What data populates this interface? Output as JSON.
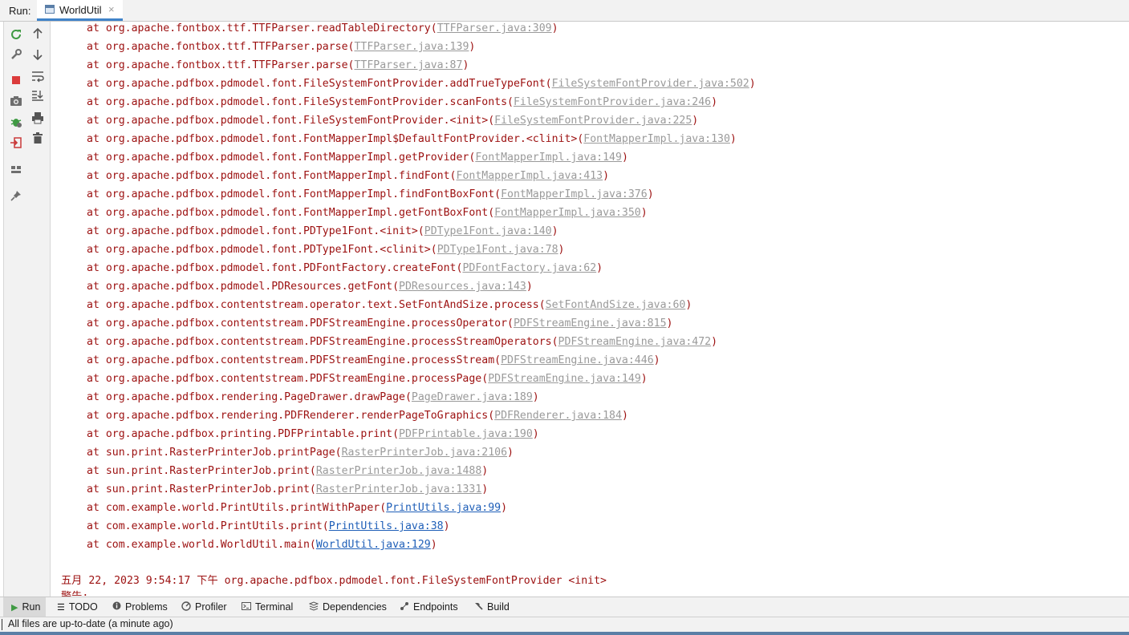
{
  "header": {
    "run_label": "Run:",
    "tab_label": "WorldUtil",
    "tab_close": "×"
  },
  "toolbar": {
    "left_icons": [
      "rerun-icon",
      "wrench-icon",
      "stop-icon",
      "camera-icon",
      "debug-bug-icon",
      "import-arrow-icon",
      "layout-icon",
      "pin-icon"
    ],
    "right_icons": [
      "arrow-up-icon",
      "arrow-down-icon",
      "soft-wrap-icon",
      "scroll-to-end-icon",
      "print-icon",
      "trash-icon"
    ]
  },
  "console": {
    "lines": [
      {
        "prefix": "at org.apache.fontbox.ttf.TTFParser.readTableDirectory(",
        "link": "TTFParser.java:309",
        "suffix": ")",
        "link_color": "gray"
      },
      {
        "prefix": "at org.apache.fontbox.ttf.TTFParser.parse(",
        "link": "TTFParser.java:139",
        "suffix": ")",
        "link_color": "gray"
      },
      {
        "prefix": "at org.apache.fontbox.ttf.TTFParser.parse(",
        "link": "TTFParser.java:87",
        "suffix": ")",
        "link_color": "gray"
      },
      {
        "prefix": "at org.apache.pdfbox.pdmodel.font.FileSystemFontProvider.addTrueTypeFont(",
        "link": "FileSystemFontProvider.java:502",
        "suffix": ")",
        "link_color": "gray"
      },
      {
        "prefix": "at org.apache.pdfbox.pdmodel.font.FileSystemFontProvider.scanFonts(",
        "link": "FileSystemFontProvider.java:246",
        "suffix": ")",
        "link_color": "gray"
      },
      {
        "prefix": "at org.apache.pdfbox.pdmodel.font.FileSystemFontProvider.<init>(",
        "link": "FileSystemFontProvider.java:225",
        "suffix": ")",
        "link_color": "gray"
      },
      {
        "prefix": "at org.apache.pdfbox.pdmodel.font.FontMapperImpl$DefaultFontProvider.<clinit>(",
        "link": "FontMapperImpl.java:130",
        "suffix": ")",
        "link_color": "gray"
      },
      {
        "prefix": "at org.apache.pdfbox.pdmodel.font.FontMapperImpl.getProvider(",
        "link": "FontMapperImpl.java:149",
        "suffix": ")",
        "link_color": "gray"
      },
      {
        "prefix": "at org.apache.pdfbox.pdmodel.font.FontMapperImpl.findFont(",
        "link": "FontMapperImpl.java:413",
        "suffix": ")",
        "link_color": "gray"
      },
      {
        "prefix": "at org.apache.pdfbox.pdmodel.font.FontMapperImpl.findFontBoxFont(",
        "link": "FontMapperImpl.java:376",
        "suffix": ")",
        "link_color": "gray"
      },
      {
        "prefix": "at org.apache.pdfbox.pdmodel.font.FontMapperImpl.getFontBoxFont(",
        "link": "FontMapperImpl.java:350",
        "suffix": ")",
        "link_color": "gray"
      },
      {
        "prefix": "at org.apache.pdfbox.pdmodel.font.PDType1Font.<init>(",
        "link": "PDType1Font.java:140",
        "suffix": ")",
        "link_color": "gray"
      },
      {
        "prefix": "at org.apache.pdfbox.pdmodel.font.PDType1Font.<clinit>(",
        "link": "PDType1Font.java:78",
        "suffix": ")",
        "link_color": "gray"
      },
      {
        "prefix": "at org.apache.pdfbox.pdmodel.font.PDFontFactory.createFont(",
        "link": "PDFontFactory.java:62",
        "suffix": ")",
        "link_color": "gray"
      },
      {
        "prefix": "at org.apache.pdfbox.pdmodel.PDResources.getFont(",
        "link": "PDResources.java:143",
        "suffix": ")",
        "link_color": "gray"
      },
      {
        "prefix": "at org.apache.pdfbox.contentstream.operator.text.SetFontAndSize.process(",
        "link": "SetFontAndSize.java:60",
        "suffix": ")",
        "link_color": "gray"
      },
      {
        "prefix": "at org.apache.pdfbox.contentstream.PDFStreamEngine.processOperator(",
        "link": "PDFStreamEngine.java:815",
        "suffix": ")",
        "link_color": "gray"
      },
      {
        "prefix": "at org.apache.pdfbox.contentstream.PDFStreamEngine.processStreamOperators(",
        "link": "PDFStreamEngine.java:472",
        "suffix": ")",
        "link_color": "gray"
      },
      {
        "prefix": "at org.apache.pdfbox.contentstream.PDFStreamEngine.processStream(",
        "link": "PDFStreamEngine.java:446",
        "suffix": ")",
        "link_color": "gray"
      },
      {
        "prefix": "at org.apache.pdfbox.contentstream.PDFStreamEngine.processPage(",
        "link": "PDFStreamEngine.java:149",
        "suffix": ")",
        "link_color": "gray"
      },
      {
        "prefix": "at org.apache.pdfbox.rendering.PageDrawer.drawPage(",
        "link": "PageDrawer.java:189",
        "suffix": ")",
        "link_color": "gray"
      },
      {
        "prefix": "at org.apache.pdfbox.rendering.PDFRenderer.renderPageToGraphics(",
        "link": "PDFRenderer.java:184",
        "suffix": ")",
        "link_color": "gray"
      },
      {
        "prefix": "at org.apache.pdfbox.printing.PDFPrintable.print(",
        "link": "PDFPrintable.java:190",
        "suffix": ")",
        "link_color": "gray"
      },
      {
        "prefix": "at sun.print.RasterPrinterJob.printPage(",
        "link": "RasterPrinterJob.java:2106",
        "suffix": ")",
        "link_color": "gray"
      },
      {
        "prefix": "at sun.print.RasterPrinterJob.print(",
        "link": "RasterPrinterJob.java:1488",
        "suffix": ")",
        "link_color": "gray"
      },
      {
        "prefix": "at sun.print.RasterPrinterJob.print(",
        "link": "RasterPrinterJob.java:1331",
        "suffix": ")",
        "link_color": "gray"
      },
      {
        "prefix": "at com.example.world.PrintUtils.printWithPaper(",
        "link": "PrintUtils.java:99",
        "suffix": ")",
        "link_color": "blue"
      },
      {
        "prefix": "at com.example.world.PrintUtils.print(",
        "link": "PrintUtils.java:38",
        "suffix": ")",
        "link_color": "blue"
      },
      {
        "prefix": "at com.example.world.WorldUtil.main(",
        "link": "WorldUtil.java:129",
        "suffix": ")",
        "link_color": "blue"
      }
    ],
    "log_line": "五月 22, 2023 9:54:17 下午 org.apache.pdfbox.pdmodel.font.FileSystemFontProvider <init>",
    "log_line_partial": "警告: ..."
  },
  "bottom_tabs": [
    {
      "label": "Run",
      "icon": "run-icon",
      "active": true
    },
    {
      "label": "TODO",
      "icon": "todo-list-icon",
      "active": false
    },
    {
      "label": "Problems",
      "icon": "problems-info-icon",
      "active": false
    },
    {
      "label": "Profiler",
      "icon": "profiler-icon",
      "active": false
    },
    {
      "label": "Terminal",
      "icon": "terminal-icon",
      "active": false
    },
    {
      "label": "Dependencies",
      "icon": "dependencies-icon",
      "active": false
    },
    {
      "label": "Endpoints",
      "icon": "endpoints-icon",
      "active": false
    },
    {
      "label": "Build",
      "icon": "hammer-icon",
      "active": false
    }
  ],
  "status": {
    "message": "All files are up-to-date (a minute ago)"
  },
  "colors": {
    "stack_text": "#9c1010",
    "link_gray": "#9a9a9a",
    "link_blue": "#1f5fb8",
    "accent": "#4083c9"
  }
}
